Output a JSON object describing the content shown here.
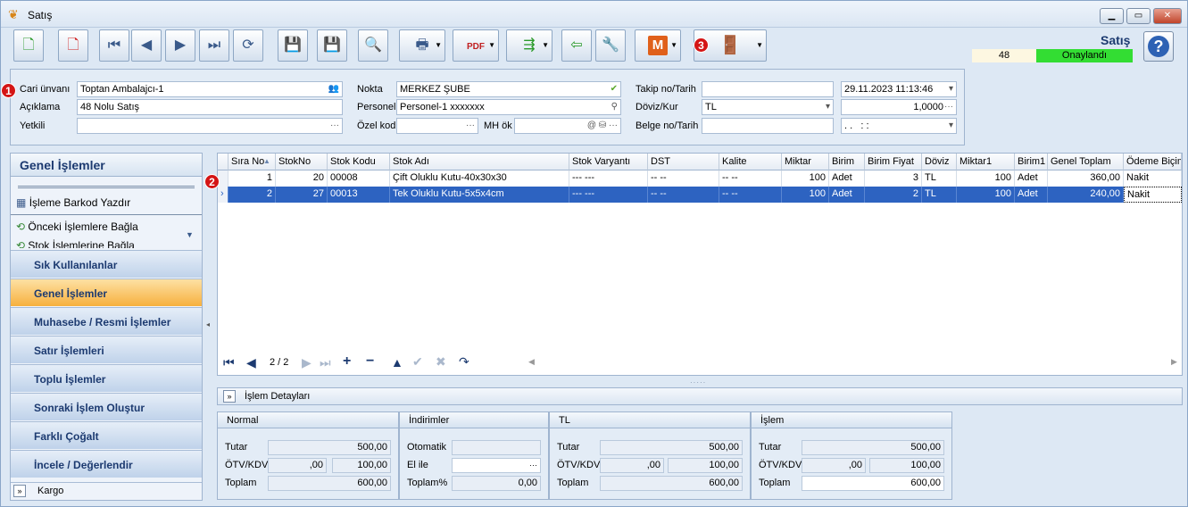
{
  "window": {
    "title": "Satış",
    "app_title": "Satış",
    "record_no": "48",
    "status": "Onaylandı"
  },
  "colors": {
    "status_bg": "#33dd33",
    "selected_row": "#2d63c1",
    "active_nav": "#f7b03e",
    "badge": "#d41515"
  },
  "badges": [
    "1",
    "2",
    "3"
  ],
  "toolbar": {
    "icons": [
      "new-doc-icon",
      "delete-doc-icon",
      "first-record-icon",
      "prev-record-icon",
      "next-record-icon",
      "last-record-icon",
      "refresh-icon",
      "save-icon",
      "save-cancel-icon",
      "preview-icon",
      "print-icon",
      "pdf-icon",
      "export-icon",
      "back-icon",
      "tools-icon",
      "m-icon",
      "exit-door-icon",
      "help-icon"
    ],
    "m_label": "M",
    "help_label": "?"
  },
  "form": {
    "cari_unvani": {
      "label": "Cari ünvanı",
      "value": "Toptan Ambalajcı-1"
    },
    "aciklama": {
      "label": "Açıklama",
      "value": "48 Nolu Satış"
    },
    "yetkili": {
      "label": "Yetkili",
      "value": ""
    },
    "nokta": {
      "label": "Nokta",
      "value": "MERKEZ ŞUBE"
    },
    "personel": {
      "label": "Personel",
      "value": "Personel-1 xxxxxxx"
    },
    "ozel_kod": {
      "label": "Özel kod",
      "value": ""
    },
    "mh_ok": {
      "label": "MH ök",
      "value": ""
    },
    "takip_no": {
      "label": "Takip no/Tarih",
      "value": "",
      "date": "29.11.2023 11:13:46"
    },
    "doviz": {
      "label": "Döviz/Kur",
      "value": "TL",
      "rate": "1,0000"
    },
    "belge_no": {
      "label": "Belge no/Tarih",
      "value": "",
      "date": ". .   : :"
    }
  },
  "left_panel": {
    "title": "Genel İşlemler",
    "items": [
      "İşleme Barkod Yazdır",
      "Önceki İşlemlere Bağla",
      "Stok İşlemlerine Bağla"
    ],
    "nav": [
      "Sık Kullanılanlar",
      "Genel İşlemler",
      "Muhasebe / Resmi İşlemler",
      "Satır İşlemleri",
      "Toplu İşlemler",
      "Sonraki İşlem Oluştur",
      "Farklı Çoğalt",
      "İncele / Değerlendir"
    ],
    "active_nav": "Genel İşlemler",
    "kargo": "Kargo"
  },
  "grid": {
    "columns": [
      "Sıra No",
      "StokNo",
      "Stok Kodu",
      "Stok Adı",
      "Stok Varyantı",
      "DST",
      "Kalite",
      "Miktar",
      "Birim",
      "Birim Fiyat",
      "Döviz",
      "Miktar1",
      "Birim1",
      "Genel Toplam",
      "Ödeme Biçimi"
    ],
    "rows": [
      [
        "1",
        "20",
        "00008",
        "Çift Oluklu Kutu-40x30x30",
        "--- ---",
        "-- --",
        "-- --",
        "100",
        "Adet",
        "3",
        "TL",
        "100",
        "Adet",
        "360,00",
        "Nakit"
      ],
      [
        "2",
        "27",
        "00013",
        "Tek Oluklu Kutu-5x5x4cm",
        "--- ---",
        "-- --",
        "-- --",
        "100",
        "Adet",
        "2",
        "TL",
        "100",
        "Adet",
        "240,00",
        "Nakit"
      ]
    ],
    "page": "2 / 2"
  },
  "details": {
    "title": "İşlem Detayları",
    "normal": {
      "title": "Normal",
      "tutar_label": "Tutar",
      "tutar": "500,00",
      "otv_label": "ÖTV/KDV",
      "otv": ",00",
      "kdv": "100,00",
      "toplam_label": "Toplam",
      "toplam": "600,00"
    },
    "indirimler": {
      "title": "İndirimler",
      "otomatik_label": "Otomatik",
      "otomatik": "",
      "elile_label": "El ile",
      "elile": "",
      "toplam_label": "Toplam%",
      "toplam": "0,00"
    },
    "tl": {
      "title": "TL",
      "tutar_label": "Tutar",
      "tutar": "500,00",
      "otv_label": "ÖTV/KDV",
      "otv": ",00",
      "kdv": "100,00",
      "toplam_label": "Toplam",
      "toplam": "600,00"
    },
    "islem": {
      "title": "İşlem",
      "tutar_label": "Tutar",
      "tutar": "500,00",
      "otv_label": "ÖTV/KDV",
      "otv": ",00",
      "kdv": "100,00",
      "toplam_label": "Toplam",
      "toplam": "600,00"
    }
  }
}
